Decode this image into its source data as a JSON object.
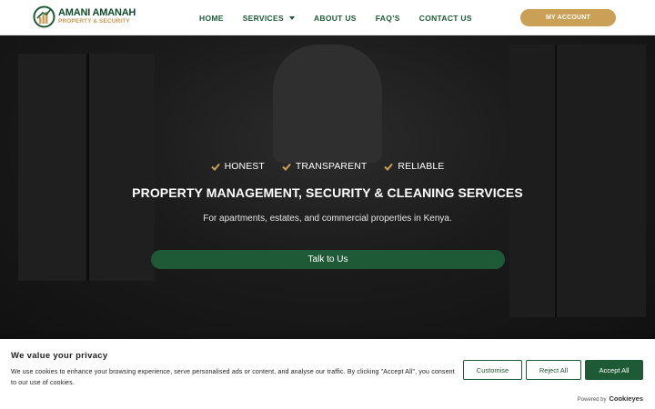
{
  "brand": {
    "name": "AMANI AMANAH",
    "tagline": "PROPERTY & SECURITY",
    "logo_icon": "bar-chart-growth-icon",
    "colors": {
      "green": "#1e5a35",
      "gold": "#c9a055"
    }
  },
  "nav": {
    "items": [
      {
        "label": "HOME"
      },
      {
        "label": "SERVICES",
        "has_dropdown": true
      },
      {
        "label": "ABOUT US"
      },
      {
        "label": "FAQ’S"
      },
      {
        "label": "CONTACT US"
      }
    ],
    "account_label": "MY ACCOUNT"
  },
  "hero": {
    "features": [
      {
        "label": "HONEST",
        "icon": "check-icon"
      },
      {
        "label": "TRANSPARENT",
        "icon": "check-icon"
      },
      {
        "label": "RELIABLE",
        "icon": "check-icon"
      }
    ],
    "title": "PROPERTY MANAGEMENT, SECURITY & CLEANING SERVICES",
    "subtitle": "For apartments, estates, and commercial properties in Kenya.",
    "cta_label": "Talk to Us"
  },
  "cookie": {
    "title": "We value your privacy",
    "text": "We use cookies to enhance your browsing experience, serve personalised ads or content, and analyse our traffic. By clicking \"Accept All\", you consent to our use of cookies.",
    "customise_label": "Customise",
    "reject_label": "Reject All",
    "accept_label": "Accept All",
    "powered_by": "Powered by",
    "powered_brand": "Cookieyes"
  }
}
